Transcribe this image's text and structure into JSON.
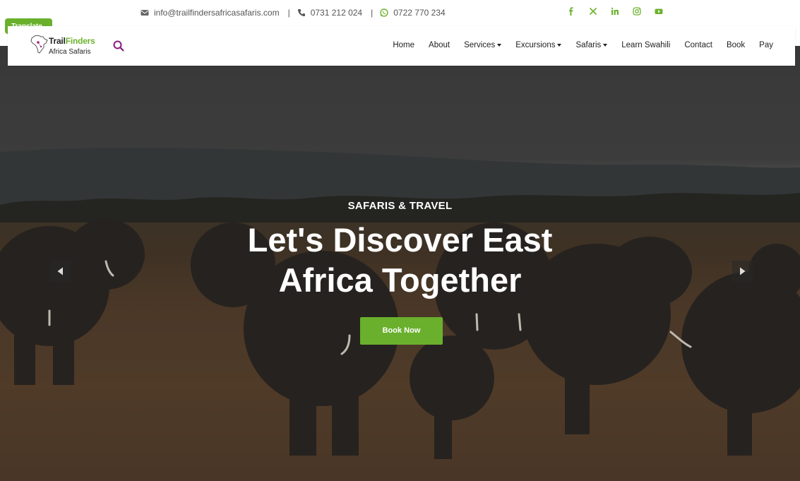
{
  "topbar": {
    "email": "info@trailfindersafricasafaris.com",
    "separator": "|",
    "phone1": "0731 212 024",
    "phone2": "0722 770 234",
    "socials": [
      "facebook-icon",
      "x-icon",
      "linkedin-icon",
      "instagram-icon",
      "youtube-icon"
    ],
    "accent_color": "#6db32e"
  },
  "translate": {
    "label": "Translate"
  },
  "logo": {
    "brand_part1": "Trail",
    "brand_part2": "Finders",
    "tagline": "Africa Safaris"
  },
  "nav": {
    "items": [
      {
        "label": "Home"
      },
      {
        "label": "About"
      },
      {
        "label": "Services"
      },
      {
        "label": "Excursions"
      },
      {
        "label": "Safaris"
      },
      {
        "label": "Learn Swahili"
      },
      {
        "label": "Contact"
      },
      {
        "label": "Book"
      },
      {
        "label": "Pay"
      }
    ]
  },
  "hero": {
    "eyebrow": "SAFARIS & TRAVEL",
    "headline_line1": "Let's Discover East",
    "headline_line2": "Africa Together",
    "cta": "Book Now",
    "cta_color": "#6ab02c"
  }
}
